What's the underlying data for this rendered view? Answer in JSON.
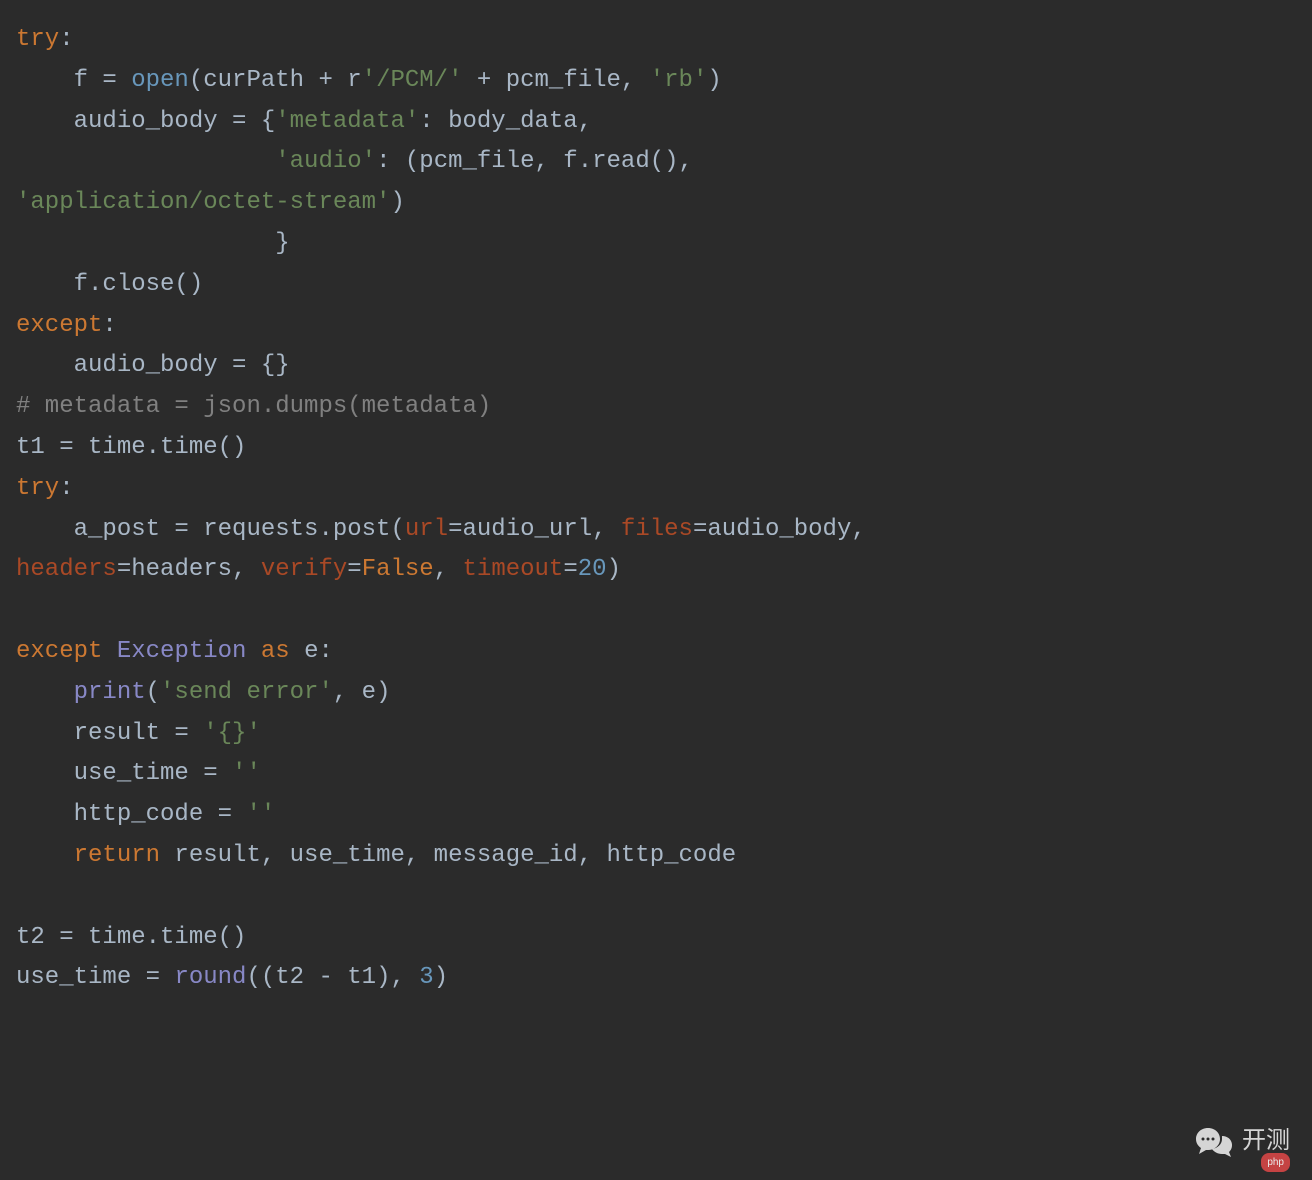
{
  "code": {
    "l1_try": "try",
    "l1_colon": ":",
    "l2_f": "    f = ",
    "l2_open": "open",
    "l2_p1": "(curPath + ",
    "l2_r": "r",
    "l2_path": "'/PCM/'",
    "l2_plus": " + pcm_file, ",
    "l2_rb": "'rb'",
    "l2_close": ")",
    "l3_a": "    audio_body = {",
    "l3_k1": "'metadata'",
    "l3_c1": ": body_data,",
    "l4_pad": "                  ",
    "l4_k2": "'audio'",
    "l4_c2": ": (pcm_file, f.read(),",
    "l5_str": "'application/octet-stream'",
    "l5_close": ")",
    "l6_brace": "                  }",
    "l7_close": "    f.close()",
    "l8_except": "except",
    "l8_colon": ":",
    "l9_body": "    audio_body = {}",
    "l10_comment": "# metadata = json.dumps(metadata)",
    "l11": "t1 = time.time()",
    "l12_try": "try",
    "l12_colon": ":",
    "l13_a": "    a_post = requests.post(",
    "l13_url": "url",
    "l13_eq1": "=audio_url, ",
    "l13_files": "files",
    "l13_eq2": "=audio_body,",
    "l14_headers": "headers",
    "l14_eq1": "=headers, ",
    "l14_verify": "verify",
    "l14_eq2": "=",
    "l14_false": "False",
    "l14_comma": ", ",
    "l14_timeout": "timeout",
    "l14_eq3": "=",
    "l14_20": "20",
    "l14_close": ")",
    "l15_blank": "",
    "l16_except": "except",
    "l16_sp": " ",
    "l16_exc": "Exception",
    "l16_as": " as ",
    "l16_e": "e:",
    "l17_print": "    print",
    "l17_p1": "(",
    "l17_str": "'send error'",
    "l17_p2": ", e)",
    "l18_a": "    result = ",
    "l18_str": "'{}'",
    "l19_a": "    use_time = ",
    "l19_str": "''",
    "l20_a": "    http_code = ",
    "l20_str": "''",
    "l21_ret": "    return",
    "l21_vals": " result, use_time, message_id, http_code",
    "l22_blank": "",
    "l23": "t2 = time.time()",
    "l24_a": "use_time = ",
    "l24_round": "round",
    "l24_p1": "((t2 - t1), ",
    "l24_3": "3",
    "l24_p2": ")"
  },
  "watermark": {
    "text": "开测",
    "badge": "php"
  }
}
